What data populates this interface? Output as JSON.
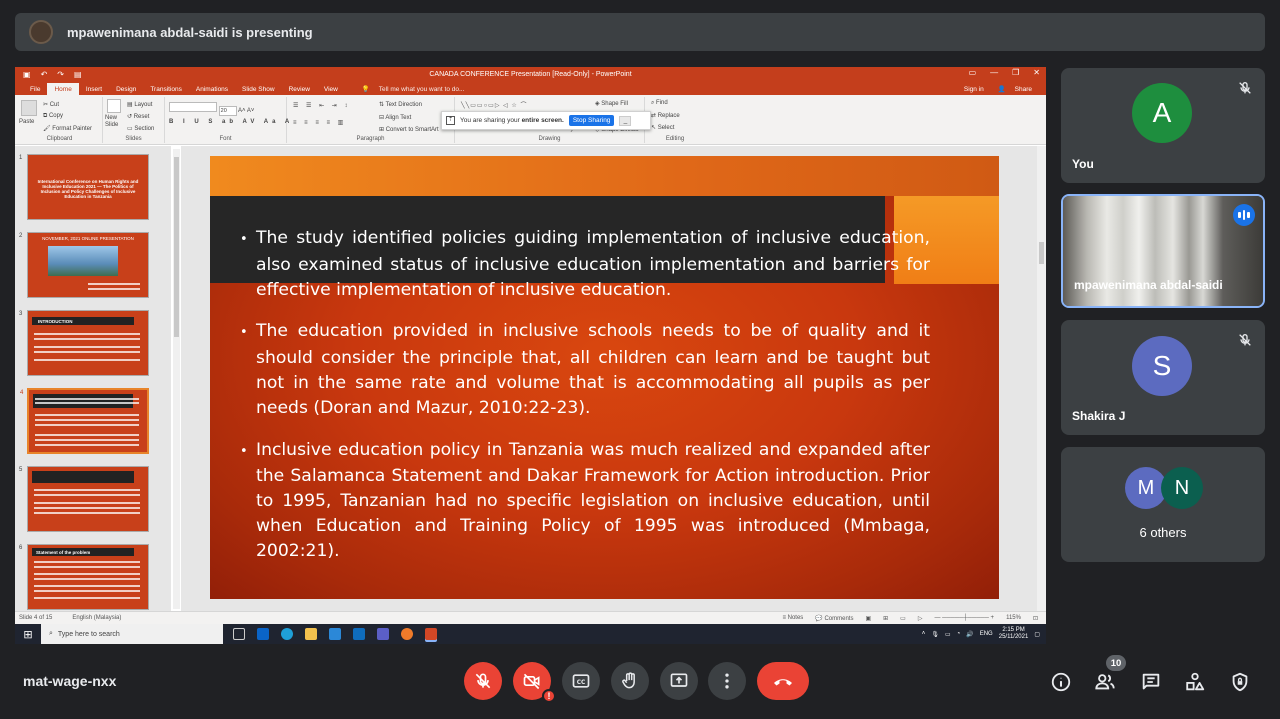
{
  "presenting_banner": "mpawenimana abdal-saidi is presenting",
  "ppt": {
    "window_title": "CANADA CONFERENCE Presentation [Read-Only] - PowerPoint",
    "menu_tabs": [
      "File",
      "Home",
      "Insert",
      "Design",
      "Transitions",
      "Animations",
      "Slide Show",
      "Review",
      "View"
    ],
    "active_tab": "Home",
    "tell_me": "Tell me what you want to do...",
    "sign_in": "Sign in",
    "share": "Share",
    "ribbon": {
      "paste": "Paste",
      "cut": "Cut",
      "copy": "Copy",
      "format_painter": "Format Painter",
      "new_slide": "New Slide",
      "layout": "Layout",
      "reset": "Reset",
      "section": "Section",
      "font_size": "20",
      "text_direction": "Text Direction",
      "align_text": "Align Text",
      "convert_smartart": "Convert to SmartArt",
      "shape_fill": "Shape Fill",
      "shape_effects": "Shape Effects",
      "styles": "Styles",
      "find": "Find",
      "replace": "Replace",
      "select": "Select",
      "groups": [
        "Clipboard",
        "Slides",
        "Font",
        "Paragraph",
        "Drawing",
        "Editing"
      ]
    },
    "share_bar": {
      "message_pre": "You are sharing your",
      "message_bold": "entire screen.",
      "stop_button": "Stop Sharing"
    },
    "thumbnails": [
      {
        "num": "1",
        "title": "International Conference on Human Rights and Inclusive Education 2021 — The Politics of Inclusion and Policy Challenges of Inclusive Education in Tanzania"
      },
      {
        "num": "2",
        "title": "NOVEMBER, 2021 ONLINE PRESENTATION"
      },
      {
        "num": "3",
        "title": "INTRODUCTION"
      },
      {
        "num": "4",
        "title": ""
      },
      {
        "num": "5",
        "title": ""
      },
      {
        "num": "6",
        "title": "Statement of the problem"
      }
    ],
    "selected_thumbnail": "4",
    "slide_bullets": [
      "The study identified policies guiding implementation of inclusive education, also examined status of inclusive education implementation and barriers for effective implementation of inclusive education.",
      "The education provided in inclusive schools needs to be of quality and it should consider the principle that, all children can learn and be taught but not in the same rate and volume that is accommodating all pupils as per needs (Doran and Mazur, 2010:22-23).",
      "Inclusive education policy in Tanzania was much realized and expanded after the Salamanca Statement and Dakar Framework for Action introduction. Prior to 1995, Tanzanian had no specific legislation on inclusive education, until when Education and Training Policy of 1995 was introduced (Mmbaga, 2002:21)."
    ],
    "status": {
      "slide_of": "Slide 4 of 15",
      "language": "English (Malaysia)",
      "notes": "Notes",
      "comments": "Comments",
      "zoom": "115%"
    },
    "taskbar": {
      "search_placeholder": "Type here to search",
      "lang": "ENG",
      "time": "2:15 PM",
      "date": "25/11/2021"
    }
  },
  "participants": [
    {
      "name": "You",
      "initial": "A",
      "color": "#1e8e3e",
      "muted": true
    },
    {
      "name": "mpawenimana abdal-saidi",
      "initial": "",
      "speaking": true
    },
    {
      "name": "Shakira J",
      "initial": "S",
      "color": "#5c6bc0",
      "muted": true
    },
    {
      "name": "6 others",
      "initials": [
        "M",
        "N"
      ],
      "colors": [
        "#5c6bc0",
        "#0b5f4f"
      ]
    }
  ],
  "meeting_code": "mat-wage-nxx",
  "people_count": "10",
  "colors": {
    "hangup": "#ea4335",
    "active_border": "#8ab4f8",
    "ppt_accent": "#c43e1c"
  }
}
